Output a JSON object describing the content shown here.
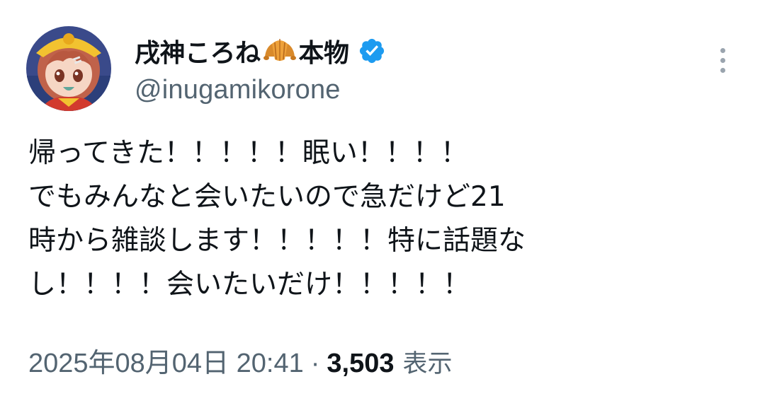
{
  "author": {
    "display_name": "戌神ころね",
    "name_suffix": "本物",
    "handle": "@inugamikorone",
    "name_emoji_icon": "croissant-icon",
    "verified_icon": "verified-badge-icon",
    "verified_color": "#1d9bf0"
  },
  "menu": {
    "icon": "more-vertical-icon"
  },
  "tweet": {
    "lines": [
      "帰ってきた！！！！！眠い！！！！",
      "でもみんなと会いたいので急だけど21",
      "時から雑談します！！！！！特に話題な",
      "し！！！！会いたいだけ！！！！！"
    ]
  },
  "meta": {
    "timestamp": "2025年08月04日 20:41",
    "separator": "·",
    "views_count": "3,503",
    "views_label": "表示"
  },
  "colors": {
    "text_primary": "#0f1419",
    "text_secondary": "#536471",
    "background": "#ffffff"
  }
}
